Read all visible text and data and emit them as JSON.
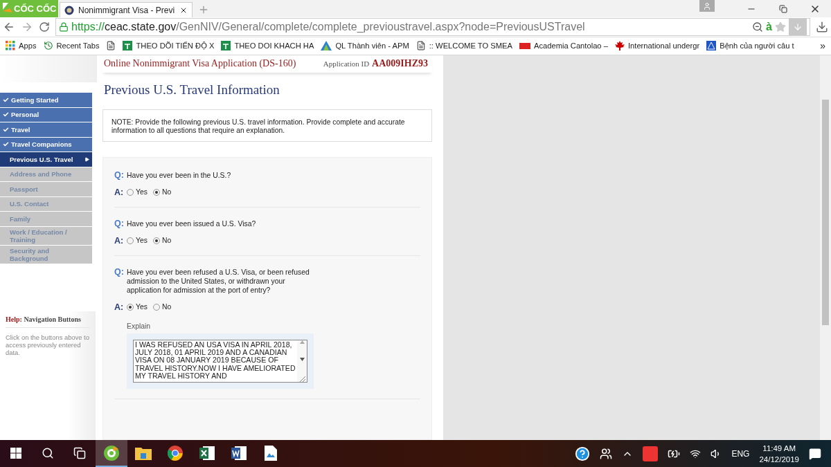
{
  "browser": {
    "logo": "CỐC CỐC",
    "tab": {
      "title": "Nonimmigrant Visa - Previ",
      "selected": true
    },
    "translate": "à",
    "url": {
      "scheme": "https://",
      "host": "ceac.state.gov",
      "path": "/GenNIV/General/complete/complete_previoustravel.aspx?node=PreviousUSTravel"
    },
    "bookmarks": [
      {
        "kind": "apps",
        "label": "Apps"
      },
      {
        "kind": "history",
        "label": "Recent Tabs"
      },
      {
        "kind": "page"
      },
      {
        "kind": "sheet",
        "label": "THEO DÕI TIẾN ĐỘ X"
      },
      {
        "kind": "sheet",
        "label": "THEO DOI KHACH HA"
      },
      {
        "kind": "triangle",
        "label": "QL Thành viên - APM"
      },
      {
        "kind": "page",
        "label": ":: WELCOME TO SMEA"
      },
      {
        "kind": "live",
        "label": "Academia Cantolao –"
      },
      {
        "kind": "leaf",
        "label": "International undergr"
      },
      {
        "kind": "blue",
        "label": "Bệnh của người câu t"
      }
    ],
    "more": "»"
  },
  "header": {
    "title": "Online Nonimmigrant Visa Application (DS-160)",
    "id_label": "Application ID",
    "id_value": "AA009IHZ93"
  },
  "sidebar": {
    "items": [
      {
        "label": "Getting Started",
        "kind": "done",
        "selected": false
      },
      {
        "label": "Personal",
        "kind": "done",
        "selected": false
      },
      {
        "label": "Travel",
        "kind": "done",
        "selected": false
      },
      {
        "label": "Travel Companions",
        "kind": "done",
        "selected": false
      },
      {
        "label": "Previous U.S. Travel",
        "kind": "current",
        "selected": true
      },
      {
        "label": "Address and Phone",
        "kind": "pending",
        "selected": false
      },
      {
        "label": "Passport",
        "kind": "pending",
        "selected": false
      },
      {
        "label": "U.S. Contact",
        "kind": "pending",
        "selected": false
      },
      {
        "label": "Family",
        "kind": "pending",
        "selected": false
      },
      {
        "label": "Work / Education / Training",
        "kind": "pending",
        "selected": false
      },
      {
        "label": "Security and Background",
        "kind": "pending",
        "selected": false
      }
    ],
    "help": {
      "label": "Help:",
      "title": "Navigation Buttons",
      "text": "Click on the buttons above to access previously entered data."
    }
  },
  "page": {
    "title": "Previous U.S. Travel Information",
    "note": "NOTE: Provide the following previous U.S. travel information. Provide complete and accurate information to all questions that require an explanation."
  },
  "questions": [
    {
      "q_mark": "Q:",
      "a_mark": "A:",
      "text": "Have you ever been in the U.S.?",
      "options": [
        {
          "label": "Yes",
          "selected": false
        },
        {
          "label": "No",
          "selected": true
        }
      ]
    },
    {
      "q_mark": "Q:",
      "a_mark": "A:",
      "text": "Have you ever been issued a U.S. Visa?",
      "options": [
        {
          "label": "Yes",
          "selected": false
        },
        {
          "label": "No",
          "selected": true
        }
      ]
    },
    {
      "q_mark": "Q:",
      "a_mark": "A:",
      "text": "Have you ever been refused a U.S. Visa, or been refused admission to the United States, or withdrawn your application for admission at the port of entry?",
      "options": [
        {
          "label": "Yes",
          "selected": true
        },
        {
          "label": "No",
          "selected": false
        }
      ],
      "explain": {
        "label": "Explain",
        "value": "I WAS REFUSED AN USA VISA IN APRIL 2018, JULY 2018, 01 APRIL 2019 AND A CANADIAN VISA ON 08 JANUARY 2019 BECAUSE OF TRAVEL HISTORY.NOW I HAVE AMELIORATED MY TRAVEL HISTORY AND"
      }
    }
  ],
  "taskbar": {
    "apps": [
      {
        "kind": "coccoc",
        "selected": true
      },
      {
        "kind": "folder",
        "selected": false
      },
      {
        "kind": "chrome",
        "selected": false
      },
      {
        "kind": "excel",
        "selected": false
      },
      {
        "kind": "word",
        "selected": false
      },
      {
        "kind": "photos",
        "selected": false
      }
    ],
    "language": "ENG",
    "time": "11:49 AM",
    "date": "24/12/2019"
  }
}
